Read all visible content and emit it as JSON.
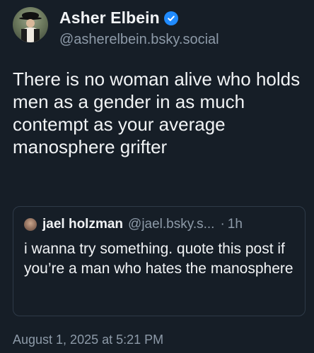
{
  "author": {
    "display_name": "Asher Elbein",
    "handle": "@asherelbein.bsky.social",
    "verified": true,
    "avatar_icon": "user-avatar"
  },
  "post": {
    "text": "There is no woman alive who holds men as a gender in as much contempt as your average manosphere grifter"
  },
  "quote": {
    "author_name": "jael holzman",
    "author_handle": "@jael.bsky.s...",
    "separator": "·",
    "time": "1h",
    "text": "i wanna try something. quote this post if you’re a man who hates the manosphere"
  },
  "timestamp": "August 1, 2025 at 5:21 PM",
  "colors": {
    "background": "#161e27",
    "text": "#f1f3f5",
    "muted": "#8d9aa8",
    "verified_badge": "#208bfe",
    "quote_border": "#2e3a48"
  }
}
